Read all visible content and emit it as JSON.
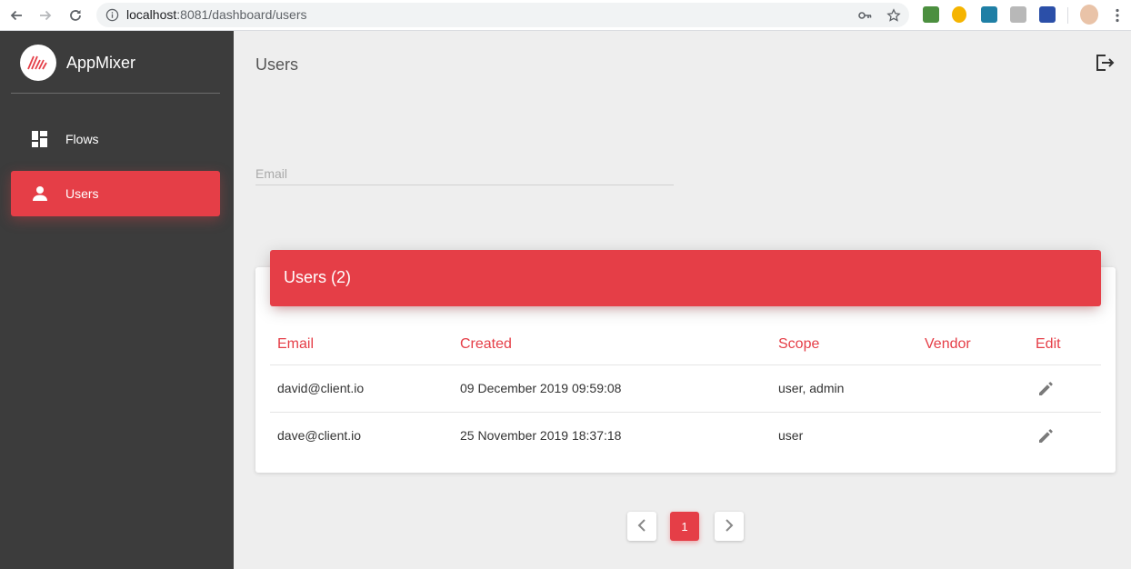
{
  "browser": {
    "url_host": "localhost",
    "url_rest": ":8081/dashboard/users",
    "icons": [
      "back-arrow-icon",
      "forward-arrow-icon",
      "reload-icon",
      "info-icon",
      "key-icon",
      "star-icon"
    ],
    "extensions": [
      "extension-green-icon",
      "extension-penguin-icon",
      "extension-wave-icon",
      "extension-grey-icon",
      "extension-blue-icon",
      "profile-avatar"
    ]
  },
  "sidebar": {
    "brand": "AppMixer",
    "brand_icon": "appmixer-logo",
    "items": [
      {
        "label": "Flows",
        "icon": "dashboard-icon",
        "active": false
      },
      {
        "label": "Users",
        "icon": "person-icon",
        "active": true
      }
    ]
  },
  "main": {
    "title": "Users",
    "logout_icon": "logout-icon",
    "filter": {
      "placeholder": "Email",
      "value": ""
    },
    "card": {
      "title": "Users (2)",
      "columns": [
        "Email",
        "Created",
        "Scope",
        "Vendor",
        "Edit"
      ],
      "rows": [
        {
          "email": "david@client.io",
          "created": "09 December 2019 09:59:08",
          "scope": "user, admin",
          "vendor": ""
        },
        {
          "email": "dave@client.io",
          "created": "25 November 2019 18:37:18",
          "scope": "user",
          "vendor": ""
        }
      ],
      "edit_icon": "pencil-icon"
    },
    "pagination": {
      "current": "1",
      "prev_icon": "chevron-left-icon",
      "next_icon": "chevron-right-icon"
    }
  },
  "colors": {
    "accent": "#e53e47",
    "sidebar": "#3c3c3c",
    "background": "#eeeeee"
  }
}
